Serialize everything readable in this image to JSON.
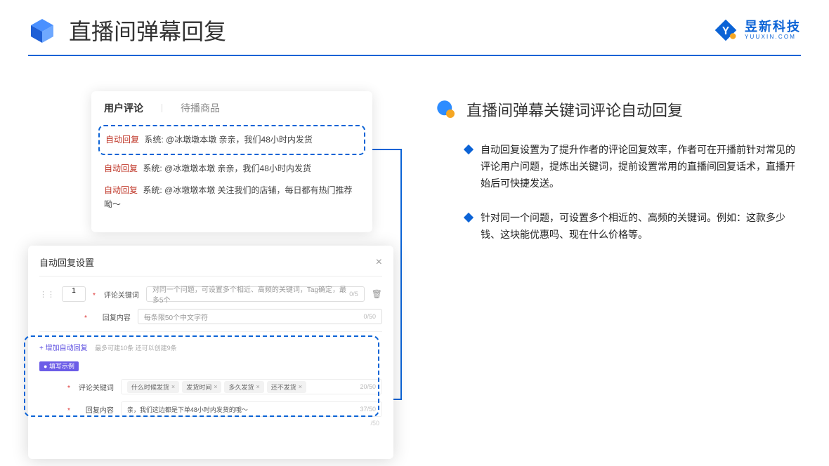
{
  "header": {
    "title": "直播间弹幕回复"
  },
  "brand": {
    "name": "昱新科技",
    "sub": "YUUXIN.COM"
  },
  "section": {
    "title": "直播间弹幕关键词评论自动回复",
    "bullets": [
      "自动回复设置为了提升作者的评论回复效率，作者可在开播前针对常见的评论用户问题，提炼出关键词，提前设置常用的直播间回复话术，直播开始后可快捷发送。",
      "针对同一个问题，可设置多个相近的、高频的关键词。例如：这款多少钱、这块能优惠吗、现在什么价格等。"
    ]
  },
  "comments": {
    "tabs": {
      "active": "用户评论",
      "inactive": "待播商品"
    },
    "items": [
      {
        "tag": "自动回复",
        "text": "系统: @冰墩墩本墩 亲亲，我们48小时内发货"
      },
      {
        "tag": "自动回复",
        "text": "系统: @冰墩墩本墩 亲亲，我们48小时内发货"
      },
      {
        "tag": "自动回复",
        "text": "系统: @冰墩墩本墩 关注我们的店铺，每日都有热门推荐呦～"
      }
    ]
  },
  "modal": {
    "title": "自动回复设置",
    "index": "1",
    "keyword_label": "评论关键词",
    "keyword_placeholder": "对同一个问题，可设置多个相近、高频的关键词，Tag确定，最多5个",
    "keyword_count": "0/5",
    "content_label": "回复内容",
    "content_placeholder": "每条限50个中文字符",
    "content_count": "0/50",
    "add_text": "+ 增加自动回复",
    "add_hint": "最多可建10条 还可以创建9条",
    "example_badge": "● 填写示例",
    "ex_keyword_label": "评论关键词",
    "ex_tags": [
      "什么时候发货",
      "发货时间",
      "多久发货",
      "还不发货"
    ],
    "ex_keyword_count": "20/50",
    "ex_content_label": "回复内容",
    "ex_content_text": "亲，我们这边都是下单48小时内发货的哦～",
    "ex_content_count": "37/50",
    "faded_count": "/50"
  }
}
